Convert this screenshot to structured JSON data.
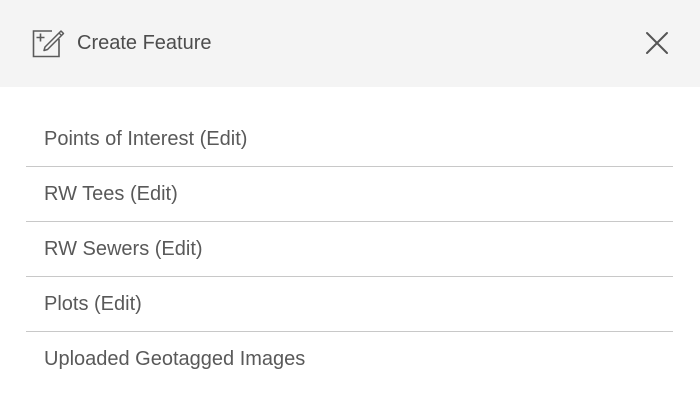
{
  "header": {
    "title": "Create Feature",
    "icon": "edit-add-icon",
    "close_icon": "close-icon"
  },
  "layers": {
    "items": [
      {
        "label": "Points of Interest (Edit)"
      },
      {
        "label": "RW Tees (Edit)"
      },
      {
        "label": "RW Sewers (Edit)"
      },
      {
        "label": "Plots (Edit)"
      },
      {
        "label": "Uploaded Geotagged Images"
      }
    ]
  },
  "colors": {
    "header_background": "#f4f4f4",
    "text": "#595959",
    "divider": "#c8c8c8"
  }
}
